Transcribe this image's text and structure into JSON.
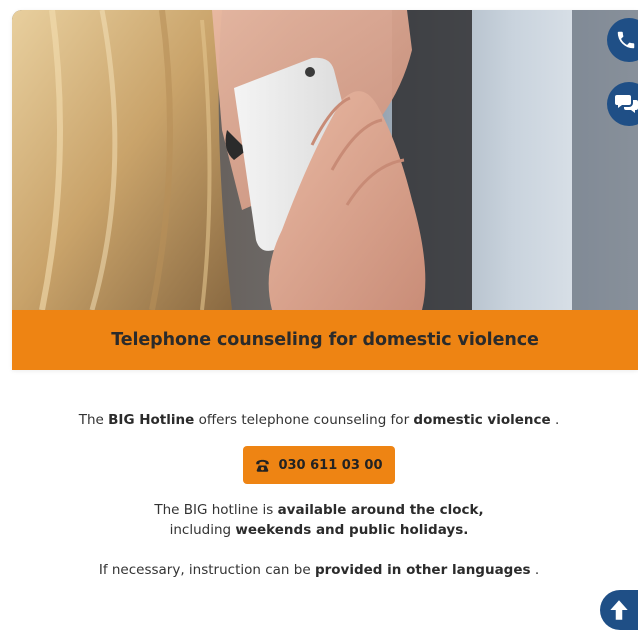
{
  "banner": {
    "title": "Telephone counseling for domestic violence"
  },
  "intro": {
    "part1": "The ",
    "brand": "BIG Hotline",
    "part2": " offers telephone counseling for ",
    "topic": "domestic violence",
    "part3": " ."
  },
  "phone_button": {
    "icon": "phone-icon",
    "number": "030 611 03 00"
  },
  "availability": {
    "line1_prefix": "The BIG hotline is ",
    "line1_bold": "available around the clock,",
    "line2_prefix": "including ",
    "line2_bold": "weekends and public holidays."
  },
  "languages": {
    "prefix": "If necessary, instruction can be ",
    "bold": "provided in other languages",
    "suffix": " ."
  },
  "side_actions": {
    "call_icon": "phone-icon",
    "chat_icon": "chat-icon"
  },
  "scroll_top": {
    "icon": "arrow-up-icon"
  },
  "colors": {
    "accent": "#ee8413",
    "brand_blue": "#1f4f86",
    "text": "#333333"
  }
}
